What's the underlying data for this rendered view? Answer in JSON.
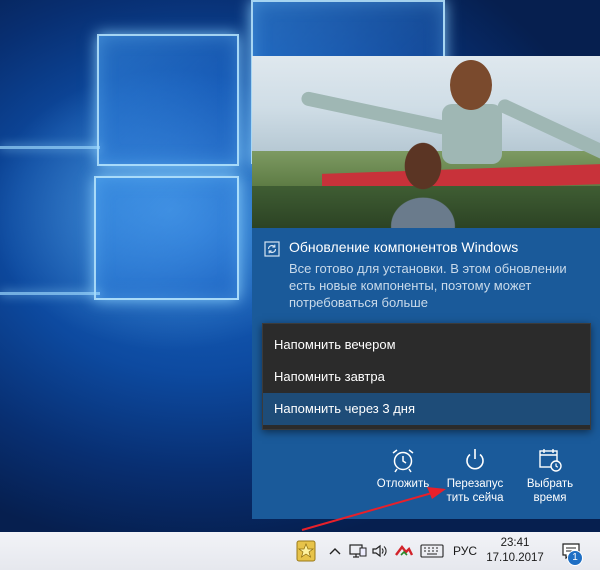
{
  "notification": {
    "title": "Обновление компонентов Windows",
    "body": "Все готово для установки. В этом обновлении есть новые компоненты, поэтому может потребоваться больше",
    "menu": [
      {
        "label": "Напомнить вечером"
      },
      {
        "label": "Напомнить завтра"
      },
      {
        "label": "Напомнить через 3 дня",
        "highlighted": true
      }
    ],
    "actions": [
      {
        "icon": "alarm-clock-icon",
        "label": "Отложить"
      },
      {
        "icon": "power-icon",
        "label": "Перезапус тить сейча"
      },
      {
        "icon": "calendar-clock-icon",
        "label": "Выбрать время"
      }
    ],
    "accent_color": "#1a5a9a"
  },
  "taskbar": {
    "language": "РУС",
    "time": "23:41",
    "date": "17.10.2017",
    "notification_count": "1",
    "icons": [
      "app-star-icon",
      "chevron-up-icon",
      "network-icon",
      "volume-icon",
      "red-tray-icon",
      "keyboard-icon",
      "action-center-icon"
    ]
  },
  "annotation": {
    "arrow_color": "#e8202a"
  }
}
